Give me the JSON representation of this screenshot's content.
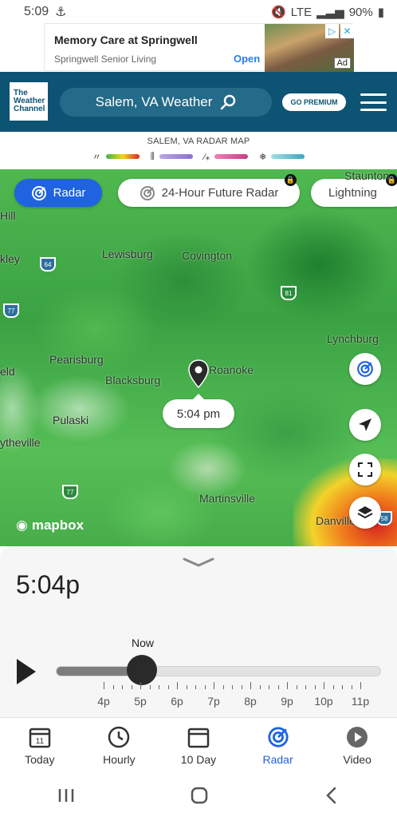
{
  "status_bar": {
    "time": "5:09",
    "network": "LTE",
    "battery": "90%"
  },
  "ad": {
    "title": "Memory Care at Springwell",
    "subtitle": "Springwell Senior Living",
    "cta": "Open",
    "tag": "Ad"
  },
  "header": {
    "logo_line1": "The",
    "logo_line2": "Weather",
    "logo_line3": "Channel",
    "location": "Salem, VA Weather",
    "premium": "GO PREMIUM"
  },
  "legend": {
    "title": "SALEM, VA RADAR MAP",
    "items": [
      {
        "icon": "rain-icon",
        "colors": [
          "#3fb34b",
          "#f3d32a",
          "#d7281e"
        ]
      },
      {
        "icon": "sleet-icon",
        "colors": [
          "#b8a6e6",
          "#8a6fd1"
        ]
      },
      {
        "icon": "mix-icon",
        "colors": [
          "#ef7fb5",
          "#c43e86"
        ]
      },
      {
        "icon": "snow-icon",
        "colors": [
          "#9fdfe5",
          "#3fa3bf"
        ]
      }
    ]
  },
  "map": {
    "chips": {
      "radar": "Radar",
      "future": "24-Hour Future Radar",
      "lightning": "Lightning"
    },
    "labels": [
      "Lewisburg",
      "Covington",
      "Lynchburg",
      "Pearisburg",
      "Blacksburg",
      "Roanoke",
      "Pulaski",
      "Martinsville",
      "Danville",
      "Staunton",
      "Hill",
      "kley",
      "eld",
      "ytheville"
    ],
    "shields": [
      "64",
      "77",
      "81",
      "77",
      "58"
    ],
    "marker_time": "5:04 pm",
    "attribution": "mapbox"
  },
  "timeline": {
    "current_time": "5:04p",
    "now_label": "Now",
    "progress": 0.26,
    "tick_labels": [
      "4p",
      "5p",
      "6p",
      "7p",
      "8p",
      "9p",
      "10p",
      "11p"
    ]
  },
  "nav": {
    "items": [
      {
        "label": "Today",
        "icon": "calendar-icon",
        "badge": "11"
      },
      {
        "label": "Hourly",
        "icon": "clock-icon"
      },
      {
        "label": "10 Day",
        "icon": "calendar-icon"
      },
      {
        "label": "Radar",
        "icon": "radar-icon"
      },
      {
        "label": "Video",
        "icon": "play-circle-icon"
      }
    ]
  },
  "colors": {
    "brand": "#0c5374",
    "accent": "#1f63e0"
  }
}
